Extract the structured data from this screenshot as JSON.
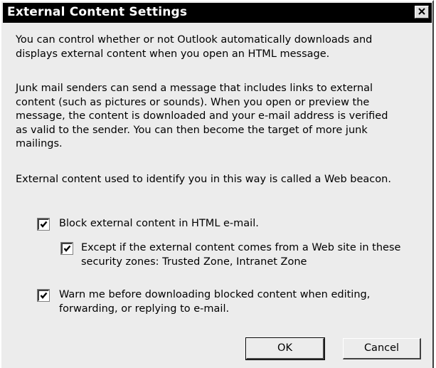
{
  "dialog": {
    "title": "External Content Settings"
  },
  "paragraphs": [
    {
      "lines": [
        "You can control whether or not Outlook automatically downloads and",
        "displays external content when you open an HTML message."
      ]
    },
    {
      "lines": [
        "Junk mail senders can send a message that includes links to external",
        "content (such as pictures or sounds).  When you open or preview the",
        "message, the content is downloaded and your e-mail address is verified",
        "as valid to the sender. You can then become the target of more junk",
        "mailings."
      ]
    },
    {
      "lines": [
        "External content used to identify you in this way is called a Web beacon."
      ]
    }
  ],
  "options": {
    "block_external": {
      "checked": true,
      "lines": [
        "Block external content in HTML e-mail."
      ]
    },
    "except_zones": {
      "checked": true,
      "lines": [
        "Except if the external content comes from a Web site in these",
        "security zones: Trusted Zone, Intranet Zone"
      ]
    },
    "warn_before": {
      "checked": true,
      "lines": [
        "Warn me before downloading blocked content when editing,",
        "forwarding, or replying to e-mail."
      ]
    }
  },
  "buttons": {
    "ok_label": "OK",
    "cancel_label": "Cancel"
  },
  "icons": {
    "close": "close-icon",
    "check": "checkmark-icon"
  }
}
